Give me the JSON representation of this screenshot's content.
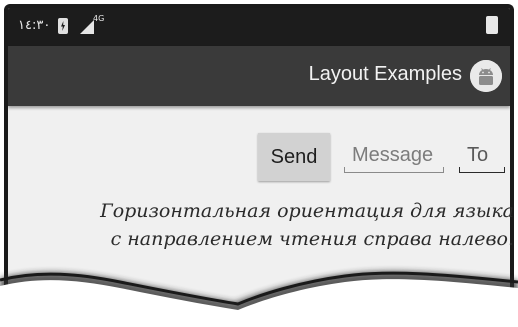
{
  "status_bar": {
    "time": "١٤:٣٠",
    "network_label": "4G",
    "icons": [
      "battery-charging-icon",
      "signal-icon",
      "battery-icon"
    ]
  },
  "app_bar": {
    "title": "Layout Examples",
    "logo_icon": "android-logo-icon"
  },
  "form": {
    "send_label": "Send",
    "message_placeholder": "Message",
    "to_placeholder": "To"
  },
  "caption": {
    "line1": "Горизонтальная ориентация для языка",
    "line2": "с направлением чтения справа налево."
  },
  "colors": {
    "status_bar": "#1c1c1c",
    "app_bar": "#3a3a3a",
    "content_bg": "#f0f0f0",
    "button_bg": "#d2d2d2"
  }
}
